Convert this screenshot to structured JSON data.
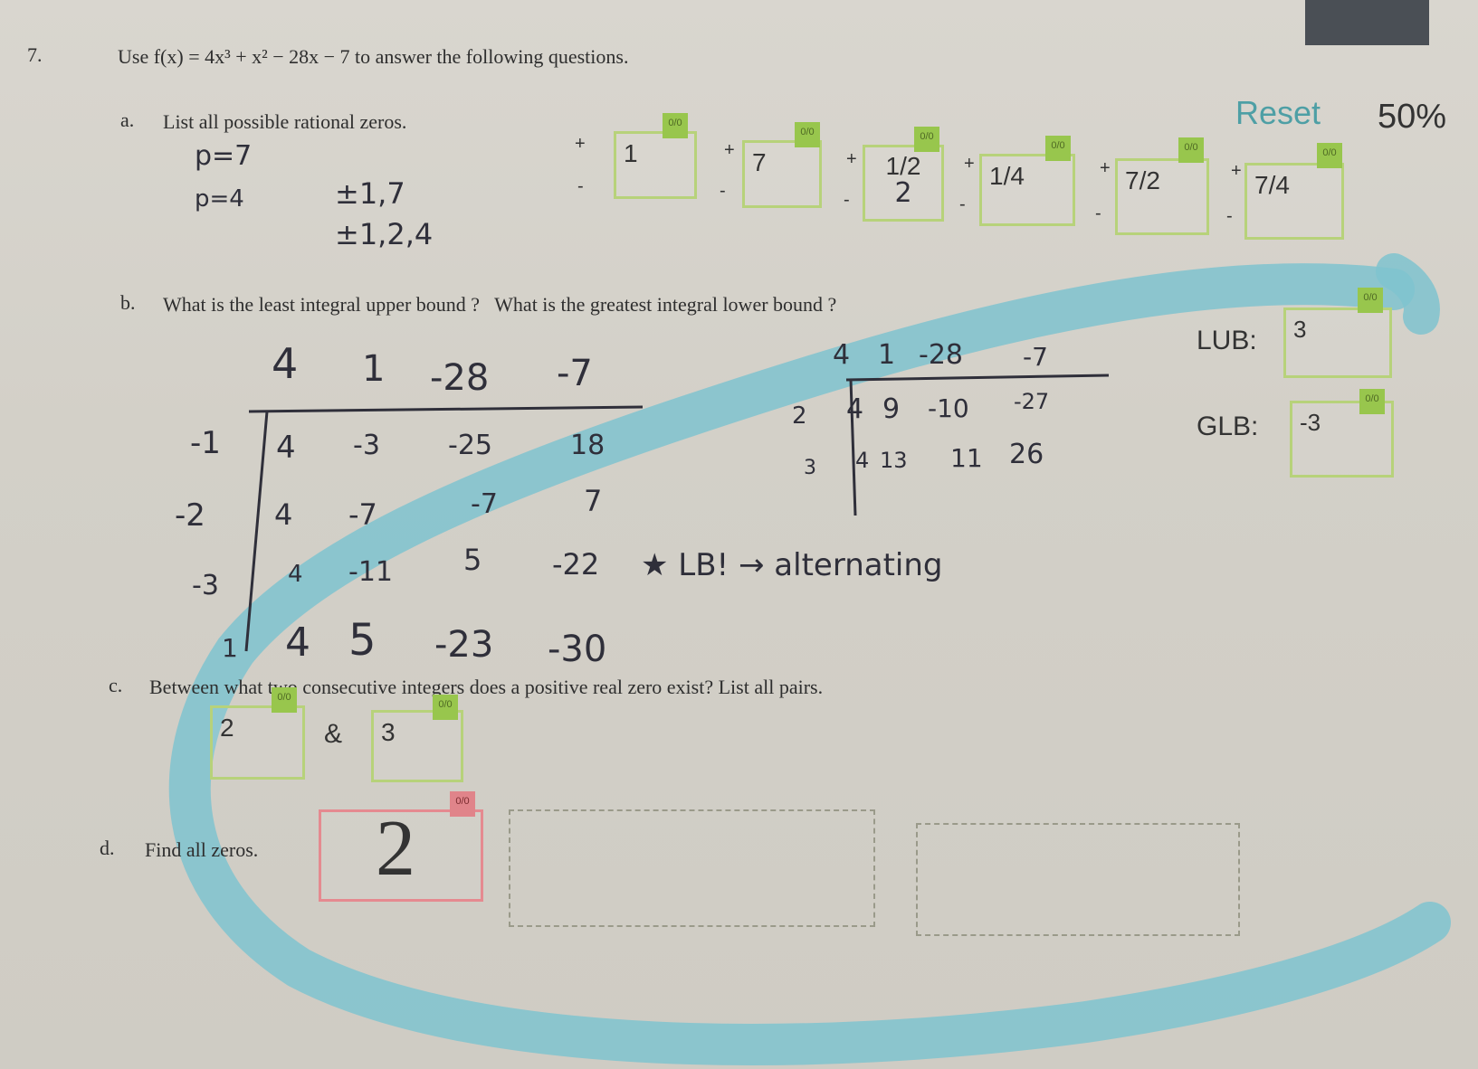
{
  "top_controls": {
    "reset_label": "Reset",
    "score_label": "50%"
  },
  "question": {
    "number": "7.",
    "prompt": "Use f(x) = 4x³ + x² − 28x − 7 to answer the following questions."
  },
  "part_a": {
    "label": "a.",
    "text": "List all possible rational zeros.",
    "hand_notes": [
      "p=7",
      "p=4",
      "±1,7",
      "±1,2,4"
    ],
    "plus_sign": "+",
    "minus_sign": "-",
    "answers": [
      {
        "value": "1",
        "denominator": "",
        "badge": "0/0"
      },
      {
        "value": "7",
        "denominator": "",
        "badge": "0/0"
      },
      {
        "value": "1/2",
        "denominator": "2",
        "badge": "0/0"
      },
      {
        "value": "1/4",
        "denominator": "",
        "badge": "0/0"
      },
      {
        "value": "7/2",
        "denominator": "",
        "badge": "0/0"
      },
      {
        "value": "7/4",
        "denominator": "",
        "badge": "0/0"
      }
    ]
  },
  "part_b": {
    "label": "b.",
    "text": "What is the least integral upper bound ?   What is the greatest integral lower bound ?",
    "lub_label": "LUB:",
    "lub_value": "3",
    "glb_label": "GLB:",
    "glb_value": "-3",
    "badge": "0/0",
    "synthetic_left": {
      "header": [
        "4",
        "1",
        "-28",
        "-7"
      ],
      "rows": [
        {
          "r": "-1",
          "vals": [
            "4",
            "-3",
            "-25",
            "18"
          ]
        },
        {
          "r": "-2",
          "vals": [
            "4",
            "-7",
            "-7",
            "7"
          ]
        },
        {
          "r": "-3",
          "vals": [
            "4",
            "-11",
            "5",
            "-22"
          ]
        },
        {
          "r": "1",
          "vals": [
            "4",
            "5",
            "-23",
            "-30"
          ]
        }
      ],
      "note": "★ LB! → alternating"
    },
    "synthetic_right": {
      "header": [
        "4",
        "1",
        "-28",
        "-7"
      ],
      "rows": [
        {
          "r": "2",
          "vals": [
            "4",
            "9",
            "-10",
            "-27"
          ]
        },
        {
          "r": "3",
          "vals": [
            "4",
            "13",
            "11",
            "26"
          ]
        }
      ]
    }
  },
  "part_c": {
    "label": "c.",
    "text": "Between what two consecutive integers does a positive real zero exist?  List all pairs.",
    "first": "2",
    "ampersand": "&",
    "second": "3",
    "badge": "0/0"
  },
  "part_d": {
    "label": "d.",
    "text": "Find all zeros.",
    "answer": "2",
    "badge": "0/0"
  }
}
